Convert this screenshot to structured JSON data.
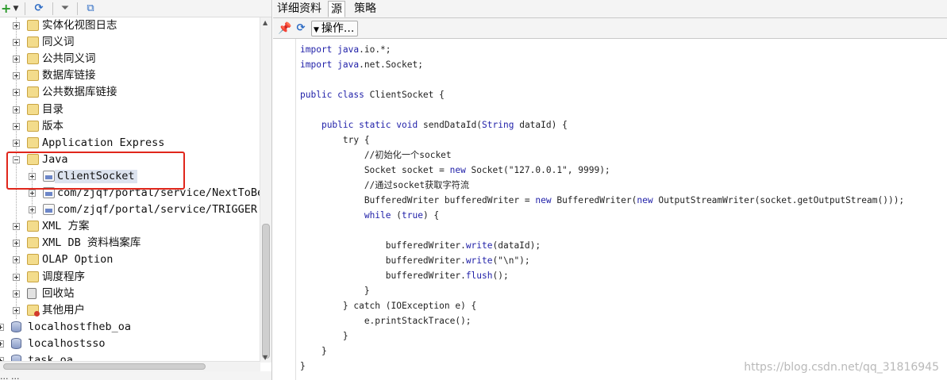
{
  "left_panel": {
    "toolbar_icons": [
      "add-icon",
      "dropdown-arrow-icon",
      "refresh-icon",
      "filter-icon",
      "collapse-icon"
    ],
    "tree": [
      {
        "label": "实体化视图日志",
        "icon": "folder-icon",
        "expander": "plus",
        "level": 1
      },
      {
        "label": "同义词",
        "icon": "folder-icon",
        "expander": "plus",
        "level": 1
      },
      {
        "label": "公共同义词",
        "icon": "folder-icon",
        "expander": "plus",
        "level": 1
      },
      {
        "label": "数据库链接",
        "icon": "folder-icon",
        "expander": "plus",
        "level": 1
      },
      {
        "label": "公共数据库链接",
        "icon": "folder-icon",
        "expander": "plus",
        "level": 1
      },
      {
        "label": "目录",
        "icon": "folder-icon",
        "expander": "plus",
        "level": 1
      },
      {
        "label": "版本",
        "icon": "folder-icon",
        "expander": "plus",
        "level": 1
      },
      {
        "label": "Application Express",
        "icon": "folder-icon",
        "expander": "plus",
        "level": 1
      },
      {
        "label": "Java",
        "icon": "folder-icon",
        "expander": "minus",
        "level": 1
      },
      {
        "label": "ClientSocket",
        "icon": "java-class-icon",
        "expander": "plus",
        "level": 2,
        "selected": true
      },
      {
        "label": "com/zjqf/portal/service/NextToBe",
        "icon": "java-class-icon",
        "expander": "plus",
        "level": 2
      },
      {
        "label": "com/zjqf/portal/service/TRIGGER",
        "icon": "java-class-icon",
        "expander": "plus",
        "level": 2
      },
      {
        "label": "XML 方案",
        "icon": "folder-icon",
        "expander": "plus",
        "level": 1
      },
      {
        "label": "XML DB 资料档案库",
        "icon": "folder-icon",
        "expander": "plus",
        "level": 1
      },
      {
        "label": "OLAP Option",
        "icon": "folder-icon",
        "expander": "plus",
        "level": 1
      },
      {
        "label": "调度程序",
        "icon": "folder-icon",
        "expander": "plus",
        "level": 1
      },
      {
        "label": "回收站",
        "icon": "recycle-bin-icon",
        "expander": "plus",
        "level": 1
      },
      {
        "label": "其他用户",
        "icon": "other-users-icon",
        "expander": "plus",
        "level": 1
      },
      {
        "label": "localhostfheb_oa",
        "icon": "database-icon",
        "expander": "plus",
        "level": 0
      },
      {
        "label": "localhostsso",
        "icon": "database-icon",
        "expander": "plus",
        "level": 0
      },
      {
        "label": "task_oa",
        "icon": "database-icon",
        "expander": "plus",
        "level": 0
      }
    ],
    "status_text": "... ..."
  },
  "right_panel": {
    "tabs": [
      {
        "label": "详细资料",
        "active": false
      },
      {
        "label": "源",
        "active": true
      },
      {
        "label": "策略",
        "active": false
      }
    ],
    "toolbar": {
      "pin_icon": "pin-icon",
      "refresh_icon": "refresh-icon",
      "actions_label": "操作..."
    },
    "code_lines": [
      [
        {
          "t": "import ",
          "c": "kw"
        },
        {
          "t": "java",
          "c": "sy"
        },
        {
          "t": ".io.*;",
          "c": ""
        }
      ],
      [
        {
          "t": "import ",
          "c": "kw"
        },
        {
          "t": "java",
          "c": "sy"
        },
        {
          "t": ".net.Socket;",
          "c": ""
        }
      ],
      [],
      [
        {
          "t": "public ",
          "c": "kw"
        },
        {
          "t": "class ",
          "c": "kw"
        },
        {
          "t": "ClientSocket {",
          "c": ""
        }
      ],
      [],
      [
        {
          "t": "    ",
          "c": ""
        },
        {
          "t": "public ",
          "c": "kw"
        },
        {
          "t": "static ",
          "c": "kw"
        },
        {
          "t": "void ",
          "c": "kw"
        },
        {
          "t": "sendDataId(",
          "c": ""
        },
        {
          "t": "String",
          "c": "sy"
        },
        {
          "t": " dataId) {",
          "c": ""
        }
      ],
      [
        {
          "t": "        try {",
          "c": ""
        }
      ],
      [
        {
          "t": "            //初始化一个socket",
          "c": ""
        }
      ],
      [
        {
          "t": "            Socket socket = ",
          "c": ""
        },
        {
          "t": "new ",
          "c": "kw"
        },
        {
          "t": "Socket(\"127.0.0.1\", 9999);",
          "c": ""
        }
      ],
      [
        {
          "t": "            //通过socket获取字符流",
          "c": ""
        }
      ],
      [
        {
          "t": "            BufferedWriter bufferedWriter = ",
          "c": ""
        },
        {
          "t": "new ",
          "c": "kw"
        },
        {
          "t": "BufferedWriter(",
          "c": ""
        },
        {
          "t": "new ",
          "c": "kw"
        },
        {
          "t": "OutputStreamWriter(socket.getOutputStream()));",
          "c": ""
        }
      ],
      [
        {
          "t": "            ",
          "c": ""
        },
        {
          "t": "while ",
          "c": "kw"
        },
        {
          "t": "(",
          "c": ""
        },
        {
          "t": "true",
          "c": "kw"
        },
        {
          "t": ") {",
          "c": ""
        }
      ],
      [],
      [
        {
          "t": "                bufferedWriter.",
          "c": ""
        },
        {
          "t": "write",
          "c": "sy"
        },
        {
          "t": "(dataId);",
          "c": ""
        }
      ],
      [
        {
          "t": "                bufferedWriter.",
          "c": ""
        },
        {
          "t": "write",
          "c": "sy"
        },
        {
          "t": "(\"\\n\");",
          "c": ""
        }
      ],
      [
        {
          "t": "                bufferedWriter.",
          "c": ""
        },
        {
          "t": "flush",
          "c": "sy"
        },
        {
          "t": "();",
          "c": ""
        }
      ],
      [
        {
          "t": "            }",
          "c": ""
        }
      ],
      [
        {
          "t": "        } catch (IOException e) {",
          "c": ""
        }
      ],
      [
        {
          "t": "            e.printStackTrace();",
          "c": ""
        }
      ],
      [
        {
          "t": "        }",
          "c": ""
        }
      ],
      [
        {
          "t": "    }",
          "c": ""
        }
      ],
      [
        {
          "t": "}",
          "c": ""
        }
      ]
    ],
    "watermark": "https://blog.csdn.net/qq_31816945"
  },
  "colors": {
    "keyword": "#1f1fa8",
    "highlight_box": "#e0261b",
    "selection": "#dce3ef"
  }
}
